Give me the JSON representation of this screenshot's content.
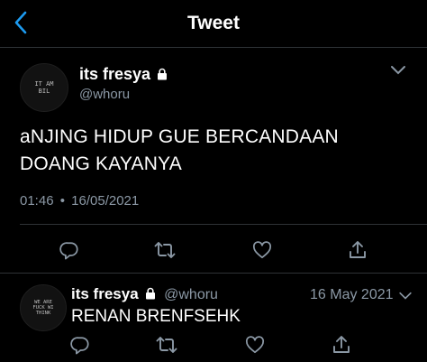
{
  "header": {
    "title": "Tweet",
    "back_icon": "chevron-left-icon"
  },
  "main_tweet": {
    "avatar_text": "IT AM\nBIL",
    "display_name": "its fresya",
    "handle": "@whoru",
    "text_line1": "aNJING HIDUP GUE BERCANDAAN",
    "text_line2": "DOANG KAYANYA",
    "time": "01:46",
    "separator": "•",
    "date": "16/05/2021"
  },
  "reply": {
    "avatar_text": "WE ARE\nFUCK WI\nTHINK",
    "display_name": "its fresya",
    "handle": "@whoru",
    "date": "16 May 2021",
    "text": "RENAN BRENFSEHK"
  },
  "colors": {
    "background": "#000000",
    "accent": "#1d9bf0",
    "muted": "#8b98a5",
    "divider": "#2f3336"
  }
}
